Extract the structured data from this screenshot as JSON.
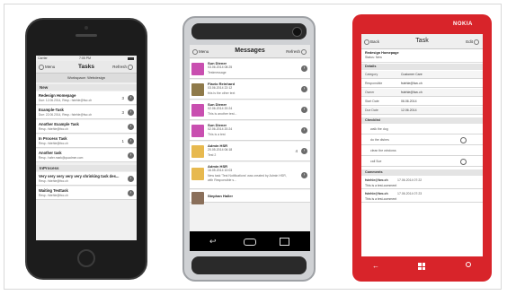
{
  "phone1": {
    "status": {
      "carrier": "Carrier",
      "time": "7:05 PM"
    },
    "navbar": {
      "left": "Menu",
      "title": "Tasks",
      "right": "Refresh"
    },
    "workspace": "Workspace: Webdesign",
    "section_new": "New",
    "tasks": [
      {
        "title": "Redesign Homepage",
        "meta": "Due: 12.06.2014, Resp.: fstehle@fwc.ch",
        "count": "3"
      },
      {
        "title": "Example-Task",
        "meta": "Due: 22.06.2014, Resp.: fstehle@fwc.ch",
        "count": "3"
      },
      {
        "title": "Another Example Task",
        "meta": "Resp.: fstehle@fwc.ch",
        "count": ""
      },
      {
        "title": "In Process Task",
        "meta": "Resp.: fstehle@fwc.ch",
        "count": "1"
      },
      {
        "title": "Another task",
        "meta": "Resp.: hafer.mark@quadmer.com",
        "count": ""
      }
    ],
    "section_inprocess": "InProcess",
    "inprocess_tasks": [
      {
        "title": "Very very very very very shrinking task des...",
        "meta": "Resp.: fstehle@fwc.ch",
        "count": ""
      },
      {
        "title": "Waiting Testtask",
        "meta": "Resp.: fstehle@fwc.ch",
        "count": ""
      }
    ]
  },
  "phone2": {
    "navbar": {
      "left": "Menu",
      "title": "Messages",
      "right": "Refresh"
    },
    "messages": [
      {
        "name": "Sun Diener",
        "date": "03.06.2014 08:25",
        "text": "Testmessage",
        "count": "",
        "color": "#c94fb0"
      },
      {
        "name": "Flavio Reinhard",
        "date": "03.06.2014 22:12",
        "text": "this is the other text",
        "count": "",
        "color": "#8f7a4a"
      },
      {
        "name": "Sun Diener",
        "date": "02.06.2014 20:24",
        "text": "This is another test...",
        "count": "",
        "color": "#c94fb0"
      },
      {
        "name": "Sun Diener",
        "date": "02.06.2014 20:24",
        "text": "This is a test",
        "count": "",
        "color": "#c94fb0"
      },
      {
        "name": "Admin HSR",
        "date": "20.05.2014 06:18",
        "text": "Test 2",
        "count": "4",
        "color": "#e7b94f"
      },
      {
        "name": "Admin HSR",
        "date": "16.05.2014 10:03",
        "text": "New task 'Test Notifications' was created by Admin HSR, with Responsible s...",
        "count": "",
        "color": "#e7b94f"
      },
      {
        "name": "Stephan Haller",
        "date": "",
        "text": "",
        "count": "",
        "color": "#8a6f5a"
      }
    ]
  },
  "phone3": {
    "brand": "NOKIA",
    "navbar": {
      "left": "Back",
      "title": "Task",
      "right": "Edit"
    },
    "header_title": "Redesign Homepage",
    "header_status": "Status: New",
    "section_details": "Details",
    "details": [
      {
        "label": "Category",
        "value": "Customer Care"
      },
      {
        "label": "Responsible",
        "value": "fstehle@fwc.ch"
      },
      {
        "label": "Owner",
        "value": "fstehle@fwc.ch"
      },
      {
        "label": "Start Date",
        "value": "06.06.2014"
      },
      {
        "label": "Due Date",
        "value": "12.06.2014"
      }
    ],
    "section_checklist": "Checklist",
    "checklist": [
      {
        "text": "walk the dog"
      },
      {
        "text": "do the dishes"
      },
      {
        "text": "clean the windows"
      },
      {
        "text": "call Sue"
      }
    ],
    "section_comments": "Comments",
    "comments": [
      {
        "author": "fstehle@fwc.ch",
        "date": "17.06.2014 07:22",
        "text": "This is a test-comment"
      },
      {
        "author": "fstehle@fwc.ch",
        "date": "17.06.2014 07:23",
        "text": "This is a test-comment"
      }
    ]
  }
}
